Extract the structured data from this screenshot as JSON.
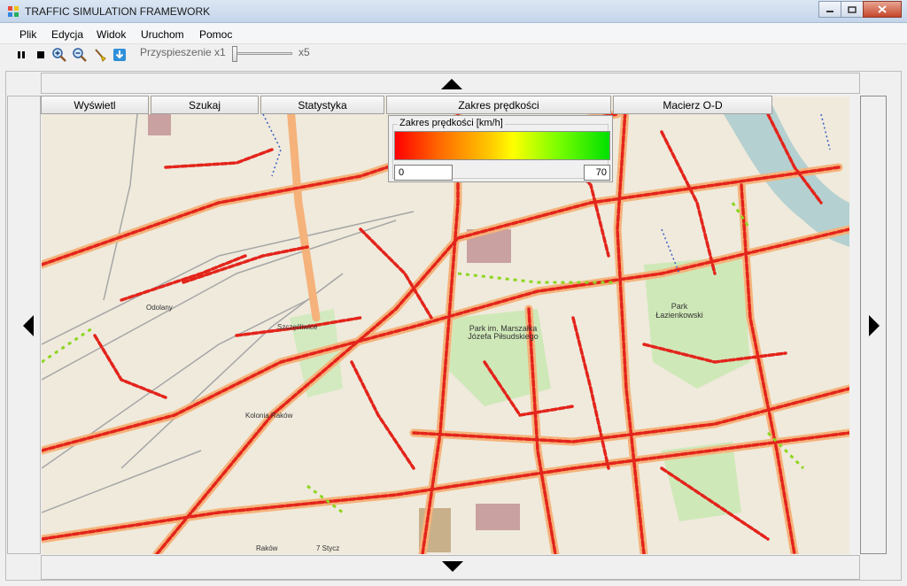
{
  "window": {
    "title": "TRAFFIC SIMULATION FRAMEWORK"
  },
  "menu": [
    "Plik",
    "Edycja",
    "Widok",
    "Uruchom",
    "Pomoc"
  ],
  "toolbar": {
    "buttons": [
      "pause-icon",
      "stop-icon",
      "zoom-in-icon",
      "zoom-out-icon",
      "brush-icon",
      "download-icon"
    ],
    "speed_label": "Przyspieszenie  x1",
    "speed_max": "x5",
    "speed_value": 1
  },
  "tabs": [
    "Wyświetl",
    "Szukaj",
    "Statystyka",
    "Zakres prędkości",
    "Macierz O-D"
  ],
  "legend": {
    "title": "Zakres prędkości [km/h]",
    "min": "0",
    "max": "70",
    "colors": [
      "#ff0000",
      "#ffff00",
      "#00e000"
    ]
  },
  "map": {
    "labels": [
      "Odolany",
      "Szczęśliwice",
      "Kolonia Raków",
      "Park im. Marszałka Józefa Piłsudskiego",
      "Park Łazienkowski",
      "Raków",
      "7 Stycz"
    ]
  }
}
